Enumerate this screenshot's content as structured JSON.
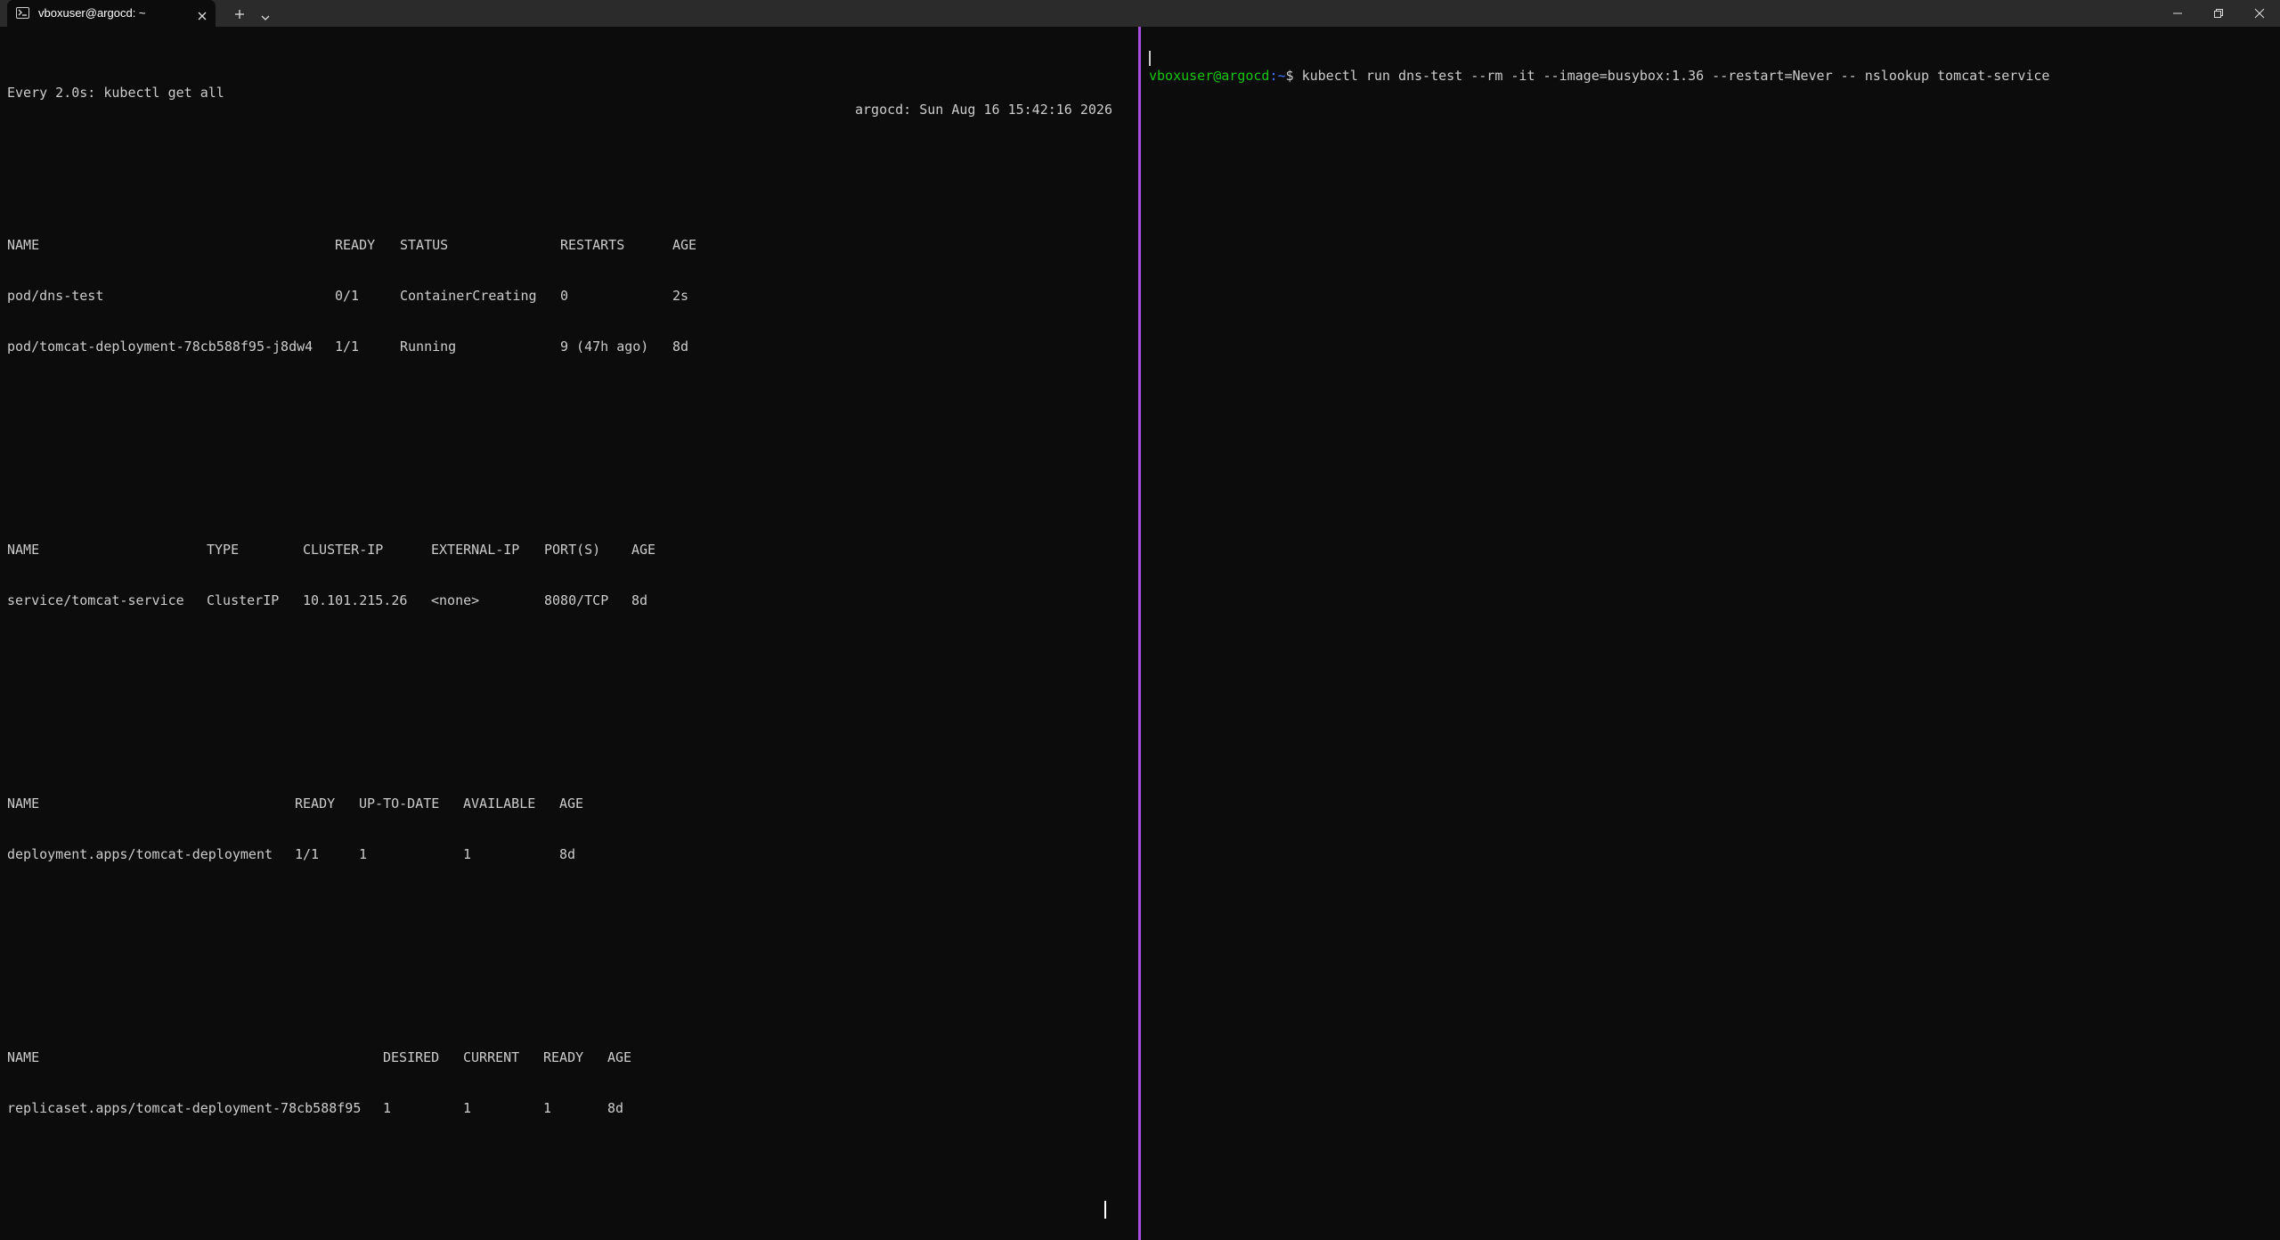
{
  "window": {
    "tab_title": "vboxuser@argocd: ~"
  },
  "left_pane": {
    "watch_command": "Every 2.0s: kubectl get all",
    "watch_clock": "argocd: Sun Aug 16 15:42:16 2026",
    "pods": {
      "headers": [
        "NAME",
        "READY",
        "STATUS",
        "RESTARTS",
        "AGE"
      ],
      "rows": [
        [
          "pod/dns-test",
          "0/1",
          "ContainerCreating",
          "0",
          "2s"
        ],
        [
          "pod/tomcat-deployment-78cb588f95-j8dw4",
          "1/1",
          "Running",
          "9 (47h ago)",
          "8d"
        ]
      ]
    },
    "services": {
      "headers": [
        "NAME",
        "TYPE",
        "CLUSTER-IP",
        "EXTERNAL-IP",
        "PORT(S)",
        "AGE"
      ],
      "rows": [
        [
          "service/tomcat-service",
          "ClusterIP",
          "10.101.215.26",
          "<none>",
          "8080/TCP",
          "8d"
        ]
      ]
    },
    "deployments": {
      "headers": [
        "NAME",
        "READY",
        "UP-TO-DATE",
        "AVAILABLE",
        "AGE"
      ],
      "rows": [
        [
          "deployment.apps/tomcat-deployment",
          "1/1",
          "1",
          "1",
          "8d"
        ]
      ]
    },
    "replicasets": {
      "headers": [
        "NAME",
        "DESIRED",
        "CURRENT",
        "READY",
        "AGE"
      ],
      "rows": [
        [
          "replicaset.apps/tomcat-deployment-78cb588f95",
          "1",
          "1",
          "1",
          "8d"
        ]
      ]
    }
  },
  "right_pane": {
    "prompt_user_host": "vboxuser@argocd",
    "prompt_path": ":~",
    "prompt_symbol": "$",
    "command": " kubectl run dns-test --rm -it --image=busybox:1.36 --restart=Never -- nslookup tomcat-service"
  },
  "colors": {
    "background": "#0c0c0c",
    "titlebar": "#2b2b2b",
    "text": "#cccccc",
    "prompt_green": "#16c60c",
    "prompt_blue": "#3b78ff",
    "pane_divider": "#a64ee0"
  }
}
